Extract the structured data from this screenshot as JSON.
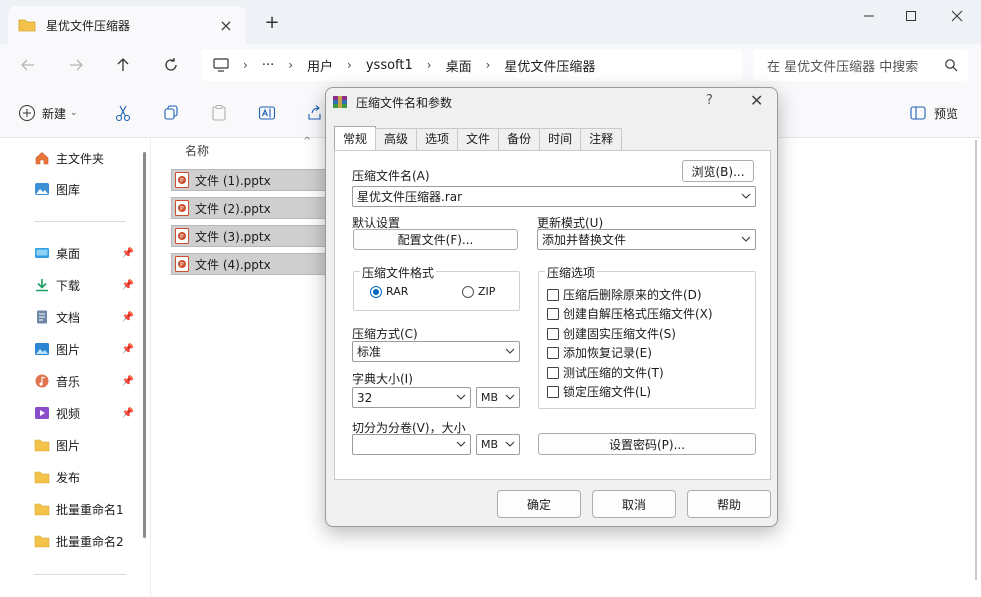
{
  "window": {
    "tab_title": "星优文件压缩器",
    "new_tab": "+",
    "controls": [
      "—",
      "☐",
      "✕"
    ]
  },
  "address": {
    "more": "···",
    "crumbs": [
      "用户",
      "yssoft1",
      "桌面",
      "星优文件压缩器"
    ],
    "sep": "›",
    "search_placeholder": "在 星优文件压缩器 中搜索"
  },
  "toolbar": {
    "new_label": "新建",
    "preview_label": "预览"
  },
  "sidebar": {
    "top": [
      {
        "label": "主文件夹",
        "icon": "home-icon"
      },
      {
        "label": "图库",
        "icon": "gallery-icon"
      }
    ],
    "pinned": [
      {
        "label": "桌面",
        "icon": "desktop-icon"
      },
      {
        "label": "下载",
        "icon": "download-icon"
      },
      {
        "label": "文档",
        "icon": "document-icon"
      },
      {
        "label": "图片",
        "icon": "picture-icon"
      },
      {
        "label": "音乐",
        "icon": "music-icon"
      },
      {
        "label": "视频",
        "icon": "video-icon"
      }
    ],
    "folders": [
      {
        "label": "图片",
        "icon": "folder-icon"
      },
      {
        "label": "发布",
        "icon": "folder-icon"
      },
      {
        "label": "批量重命名1",
        "icon": "folder-icon"
      },
      {
        "label": "批量重命名2",
        "icon": "folder-icon"
      }
    ]
  },
  "files": {
    "column_name": "名称",
    "items": [
      "文件 (1).pptx",
      "文件 (2).pptx",
      "文件 (3).pptx",
      "文件 (4).pptx"
    ]
  },
  "dialog": {
    "title": "压缩文件名和参数",
    "help": "?",
    "close": "✕",
    "tabs": [
      "常规",
      "高级",
      "选项",
      "文件",
      "备份",
      "时间",
      "注释"
    ],
    "archive_name_label": "压缩文件名(A)",
    "browse_label": "浏览(B)...",
    "archive_name_value": "星优文件压缩器.rar",
    "default_settings_label": "默认设置",
    "profiles_label": "配置文件(F)...",
    "update_mode_label": "更新模式(U)",
    "update_mode_value": "添加并替换文件",
    "format_label": "压缩文件格式",
    "format_rar": "RAR",
    "format_zip": "ZIP",
    "selected_format": "RAR",
    "options_label": "压缩选项",
    "options": [
      "压缩后删除原来的文件(D)",
      "创建自解压格式压缩文件(X)",
      "创建固实压缩文件(S)",
      "添加恢复记录(E)",
      "测试压缩的文件(T)",
      "锁定压缩文件(L)"
    ],
    "method_label": "压缩方式(C)",
    "method_value": "标准",
    "dict_label": "字典大小(I)",
    "dict_value": "32",
    "dict_unit": "MB",
    "split_label": "切分为分卷(V)，大小",
    "split_value": "",
    "split_unit": "MB",
    "password_label": "设置密码(P)...",
    "ok_label": "确定",
    "cancel_label": "取消",
    "help_label": "帮助"
  },
  "colors": {
    "accent": "#0067c0",
    "folder": "#f3c24a",
    "pptx": "#c8502d"
  }
}
